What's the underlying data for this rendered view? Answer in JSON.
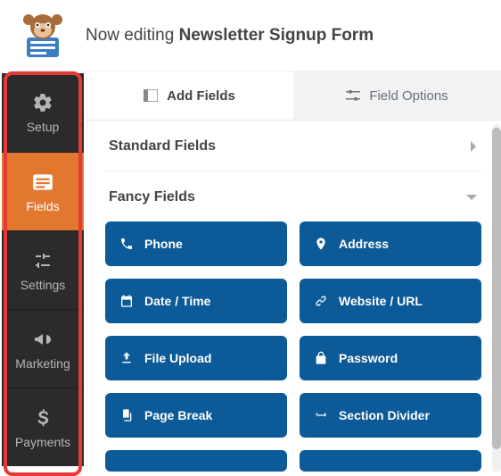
{
  "header": {
    "prefix": "Now editing ",
    "title": "Newsletter Signup Form"
  },
  "sidebar": {
    "items": [
      {
        "label": "Setup"
      },
      {
        "label": "Fields"
      },
      {
        "label": "Settings"
      },
      {
        "label": "Marketing"
      },
      {
        "label": "Payments"
      }
    ]
  },
  "tabs": {
    "add": "Add Fields",
    "options": "Field Options"
  },
  "groups": {
    "standard": "Standard Fields",
    "fancy": "Fancy Fields"
  },
  "fields": {
    "phone": "Phone",
    "address": "Address",
    "datetime": "Date / Time",
    "website": "Website / URL",
    "upload": "File Upload",
    "password": "Password",
    "pagebreak": "Page Break",
    "section": "Section Divider"
  }
}
